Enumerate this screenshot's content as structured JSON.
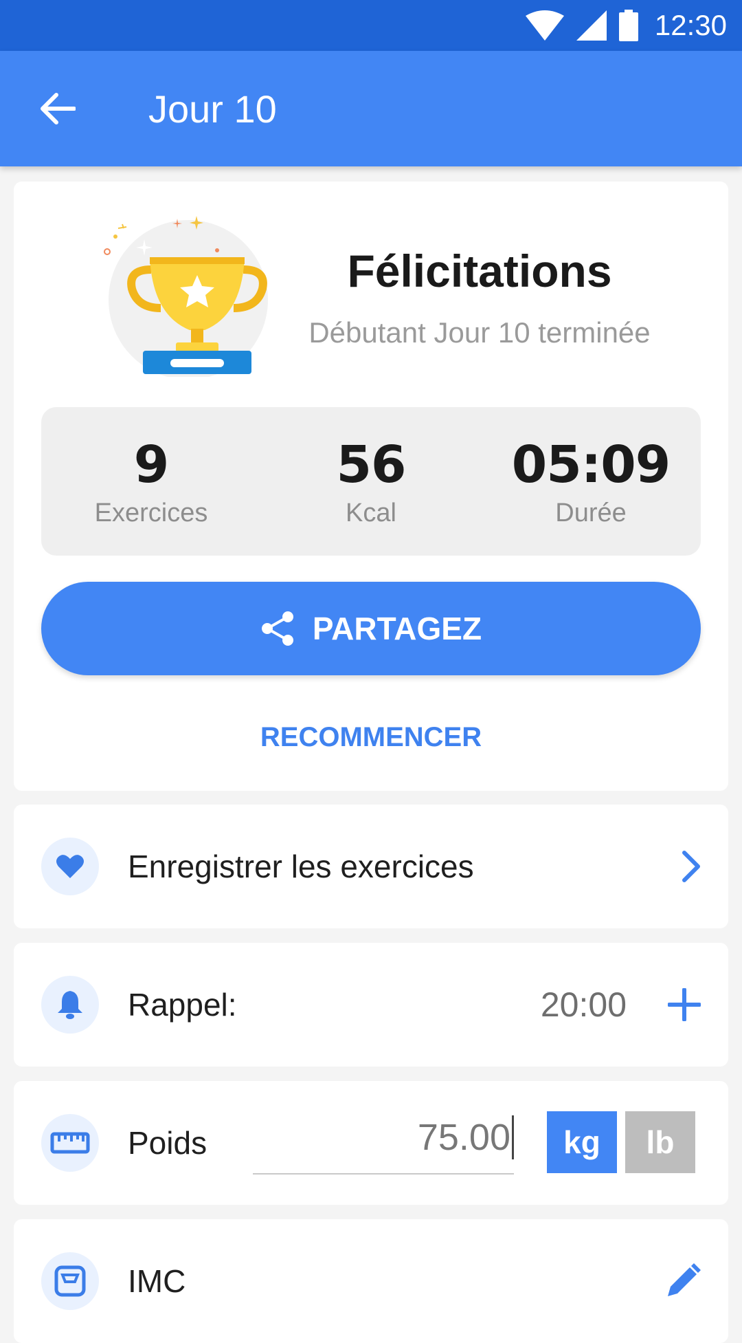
{
  "status_bar": {
    "time": "12:30"
  },
  "app_bar": {
    "title": "Jour 10"
  },
  "summary": {
    "title": "Félicitations",
    "subtitle": "Débutant Jour 10 terminée",
    "stats": [
      {
        "value": "9",
        "label": "Exercices"
      },
      {
        "value": "56",
        "label": "Kcal"
      },
      {
        "value": "05:09",
        "label": "Durée"
      }
    ],
    "share_label": "PARTAGEZ",
    "restart_label": "RECOMMENCER"
  },
  "rows": {
    "log": {
      "label": "Enregistrer les exercices",
      "icon": "heart-icon"
    },
    "reminder": {
      "label": "Rappel:",
      "time": "20:00",
      "icon": "bell-icon"
    },
    "weight": {
      "label": "Poids",
      "value": "75.00",
      "unit_kg": "kg",
      "unit_lb": "lb",
      "selected_unit": "kg",
      "icon": "ruler-icon"
    },
    "bmi": {
      "label": "IMC",
      "icon": "scale-icon"
    }
  },
  "colors": {
    "primary": "#4286f4",
    "status_bar": "#1f64d6",
    "accent_text": "#3f82ef"
  }
}
